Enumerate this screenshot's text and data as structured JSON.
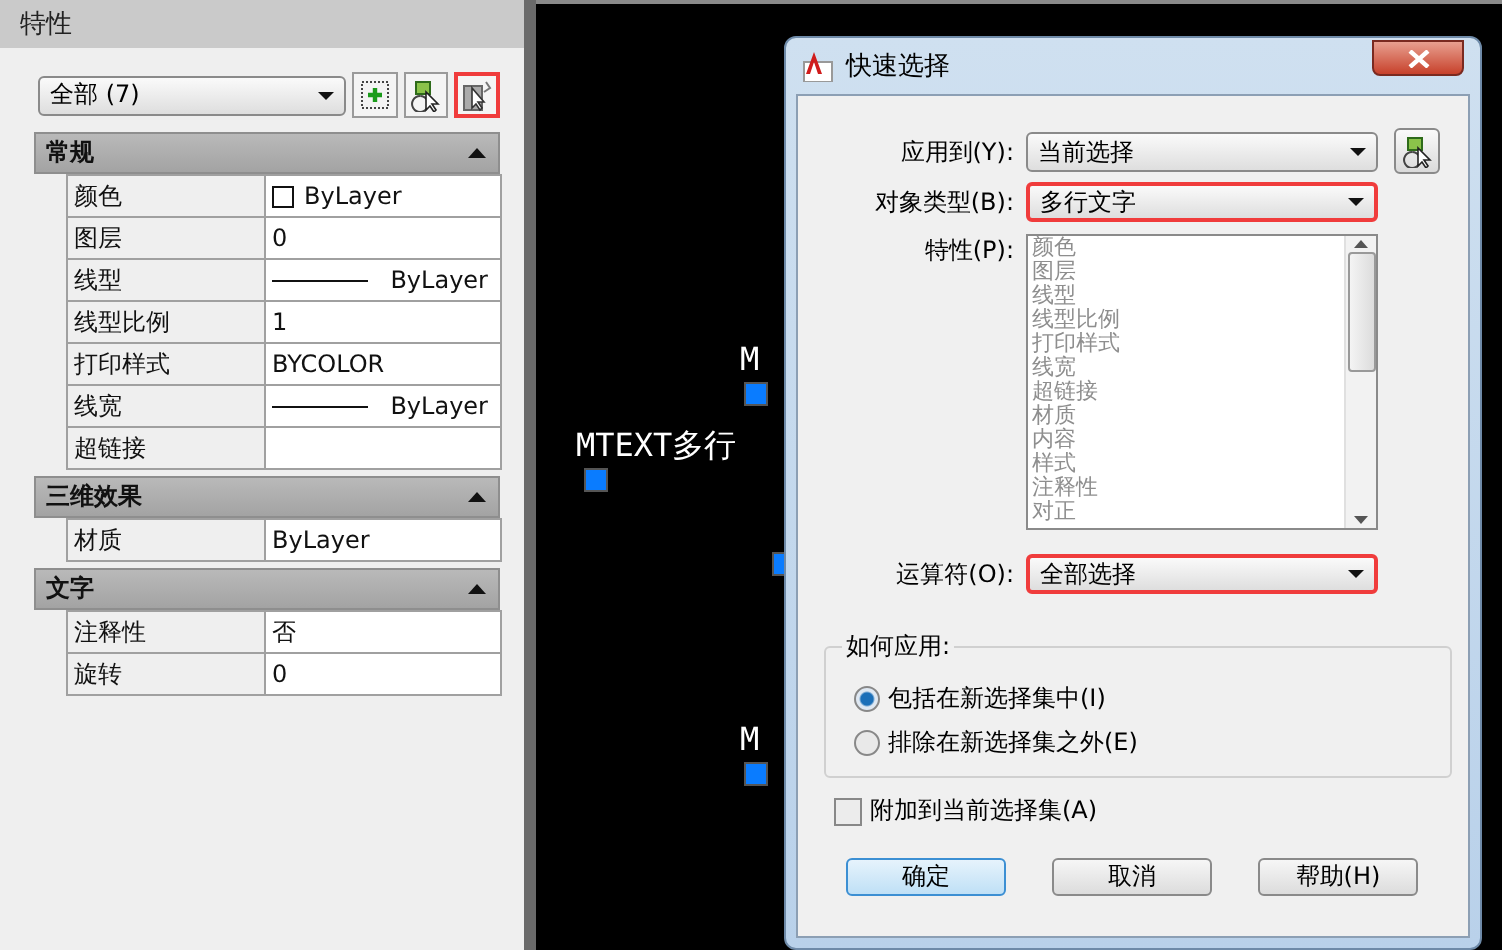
{
  "panel": {
    "title": "特性",
    "filter": {
      "value": "全部 (7)"
    },
    "tools": [
      {
        "kind": "pickadd",
        "highlighted": false
      },
      {
        "kind": "select",
        "highlighted": false
      },
      {
        "kind": "quickselect",
        "highlighted": true
      }
    ],
    "sections": [
      {
        "title": "常规",
        "expanded": true,
        "rows": [
          {
            "label": "颜色",
            "value": "ByLayer",
            "kind": "color"
          },
          {
            "label": "图层",
            "value": "0",
            "kind": "text"
          },
          {
            "label": "线型",
            "value": "ByLayer",
            "kind": "linetype"
          },
          {
            "label": "线型比例",
            "value": "1",
            "kind": "text"
          },
          {
            "label": "打印样式",
            "value": "BYCOLOR",
            "kind": "text"
          },
          {
            "label": "线宽",
            "value": "ByLayer",
            "kind": "linetype"
          },
          {
            "label": "超链接",
            "kind": "text"
          }
        ]
      },
      {
        "title": "三维效果",
        "expanded": true,
        "rows": [
          {
            "label": "材质",
            "value": "ByLayer",
            "kind": "text"
          }
        ]
      },
      {
        "title": "文字",
        "expanded": true,
        "rows": [
          {
            "label": "注释性",
            "value": "否",
            "kind": "text"
          },
          {
            "label": "旋转",
            "value": "0",
            "kind": "text"
          }
        ]
      }
    ]
  },
  "canvas": {
    "texts": [
      "M",
      "MTEXT多行",
      "M"
    ]
  },
  "dialog": {
    "title": "快速选择",
    "fields": [
      {
        "label": "应用到(Y):",
        "kind": "combo",
        "value": "当前选择",
        "highlighted": false,
        "pick_button": true
      },
      {
        "label": "对象类型(B):",
        "kind": "combo",
        "value": "多行文字",
        "highlighted": true
      },
      {
        "label": "特性(P):",
        "kind": "list",
        "disabled": true,
        "items": [
          "颜色",
          "图层",
          "线型",
          "线型比例",
          "打印样式",
          "线宽",
          "超链接",
          "材质",
          "内容",
          "样式",
          "注释性",
          "对正"
        ]
      },
      {
        "label": "运算符(O):",
        "kind": "combo",
        "value": "全部选择",
        "highlighted": true
      }
    ],
    "apply": {
      "title": "如何应用:",
      "options": [
        {
          "label": "包括在新选择集中(I)",
          "selected": true
        },
        {
          "label": "排除在新选择集之外(E)",
          "selected": false
        }
      ]
    },
    "append": {
      "label": "附加到当前选择集(A)",
      "checked": false
    },
    "buttons": [
      {
        "label": "确定",
        "default": true
      },
      {
        "label": "取消",
        "default": false
      },
      {
        "label": "帮助(H)",
        "default": false
      }
    ]
  }
}
